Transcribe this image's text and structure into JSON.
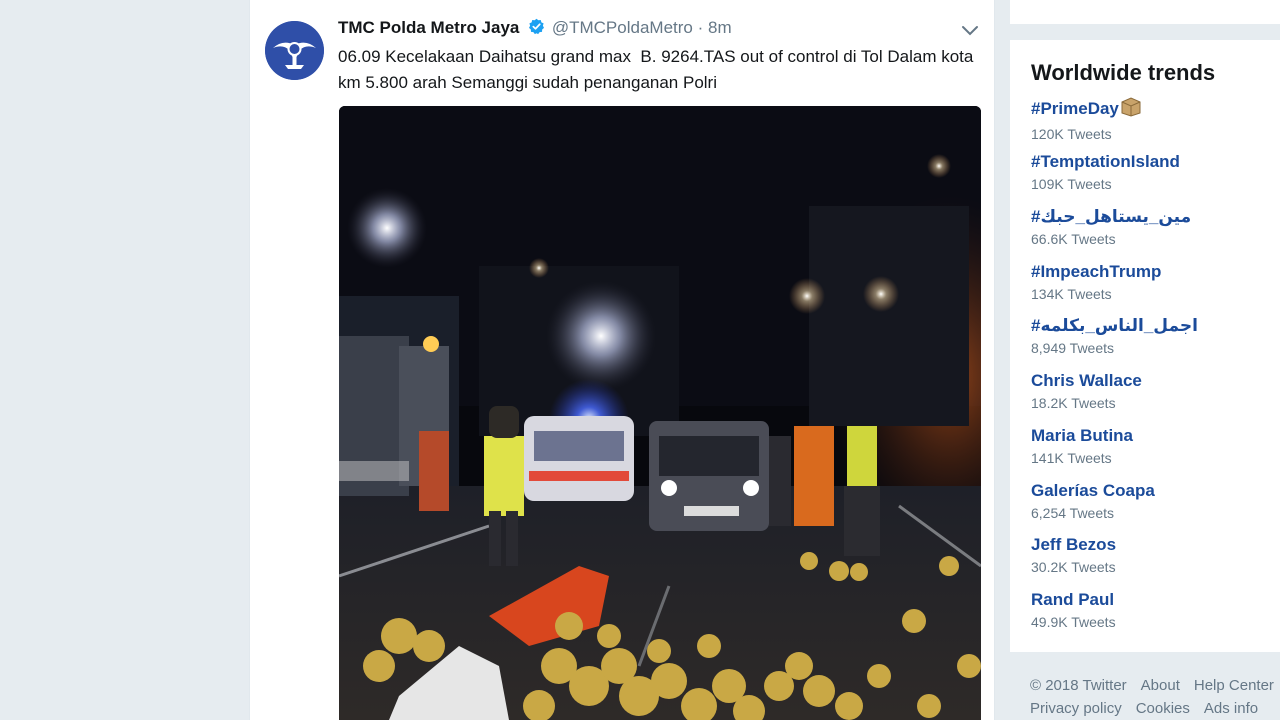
{
  "tweet": {
    "display_name": "TMC Polda Metro Jaya",
    "handle": "@TMCPoldaMetro",
    "separator": "·",
    "time": "8m",
    "text": "06.09 Kecelakaan Daihatsu grand max  B. 9264.TAS out of control di Tol Dalam kota km 5.800 arah Semanggi sudah penanganan Polri",
    "verified_icon": "verified-badge-icon",
    "menu_icon": "chevron-down-icon",
    "avatar_icon": "police-emblem"
  },
  "trends": {
    "title": "Worldwide trends",
    "items": [
      {
        "name": "#PrimeDay",
        "count": "120K Tweets",
        "icon": "package-emoji"
      },
      {
        "name": "#TemptationIsland",
        "count": "109K Tweets"
      },
      {
        "name": "#مين_يستاهل_حبك",
        "count": "66.6K Tweets"
      },
      {
        "name": "#ImpeachTrump",
        "count": "134K Tweets"
      },
      {
        "name": "#اجمل_الناس_بكلمه",
        "count": "8,949 Tweets"
      },
      {
        "name": "Chris Wallace",
        "count": "18.2K Tweets"
      },
      {
        "name": "Maria Butina",
        "count": "141K Tweets"
      },
      {
        "name": "Galerías Coapa",
        "count": "6,254 Tweets"
      },
      {
        "name": "Jeff Bezos",
        "count": "30.2K Tweets"
      },
      {
        "name": "Rand Paul",
        "count": "49.9K Tweets"
      }
    ]
  },
  "footer": {
    "copyright": "© 2018 Twitter",
    "about": "About",
    "help": "Help Center",
    "privacy": "Privacy policy",
    "cookies": "Cookies",
    "ads": "Ads info"
  },
  "colors": {
    "page_bg": "#e6ecf0",
    "trend_link": "#1b4b9a",
    "muted": "#657786",
    "verified": "#1da1f2"
  }
}
